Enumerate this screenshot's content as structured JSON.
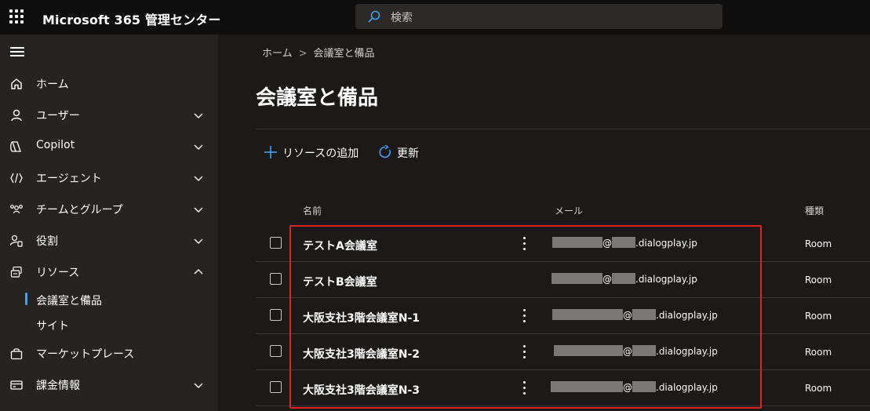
{
  "header": {
    "app_title": "Microsoft 365 管理センター",
    "search_placeholder": "検索"
  },
  "sidebar": {
    "items": [
      {
        "label": "ホーム",
        "icon": "home-icon",
        "chevron": "none"
      },
      {
        "label": "ユーザー",
        "icon": "person-icon",
        "chevron": "down"
      },
      {
        "label": "Copilot",
        "icon": "copilot-icon",
        "chevron": "down"
      },
      {
        "label": "エージェント",
        "icon": "agent-icon",
        "chevron": "down"
      },
      {
        "label": "チームとグループ",
        "icon": "people-team-icon",
        "chevron": "down"
      },
      {
        "label": "役割",
        "icon": "role-icon",
        "chevron": "down"
      },
      {
        "label": "リソース",
        "icon": "resources-icon",
        "chevron": "up"
      }
    ],
    "sub_items": [
      {
        "label": "会議室と備品",
        "active": true
      },
      {
        "label": "サイト",
        "active": false
      }
    ],
    "items_after": [
      {
        "label": "マーケットプレース",
        "icon": "bag-icon",
        "chevron": "none"
      },
      {
        "label": "課金情報",
        "icon": "card-icon",
        "chevron": "down"
      }
    ]
  },
  "main": {
    "breadcrumb": [
      "ホーム",
      "会議室と備品"
    ],
    "title": "会議室と備品",
    "commands": {
      "add_label": "リソースの追加",
      "refresh_label": "更新"
    },
    "table": {
      "columns": [
        "名前",
        "メール",
        "種類"
      ],
      "rows": [
        {
          "name": "テストA会議室",
          "mail_suffix": ".dialogplay.jp",
          "type": "Room"
        },
        {
          "name": "テストB会議室",
          "mail_suffix": ".dialogplay.jp",
          "type": "Room"
        },
        {
          "name": "大阪支社3階会議室N-1",
          "mail_suffix": ".dialogplay.jp",
          "type": "Room"
        },
        {
          "name": "大阪支社3階会議室N-2",
          "mail_suffix": ".dialogplay.jp",
          "type": "Room"
        },
        {
          "name": "大阪支社3階会議室N-3",
          "mail_suffix": ".dialogplay.jp",
          "type": "Room"
        }
      ],
      "at_sign": "@"
    }
  },
  "colors": {
    "accent": "#479ef5",
    "highlight": "#e02424",
    "topbar": "#0f0f0f",
    "sidebar": "#252423"
  }
}
